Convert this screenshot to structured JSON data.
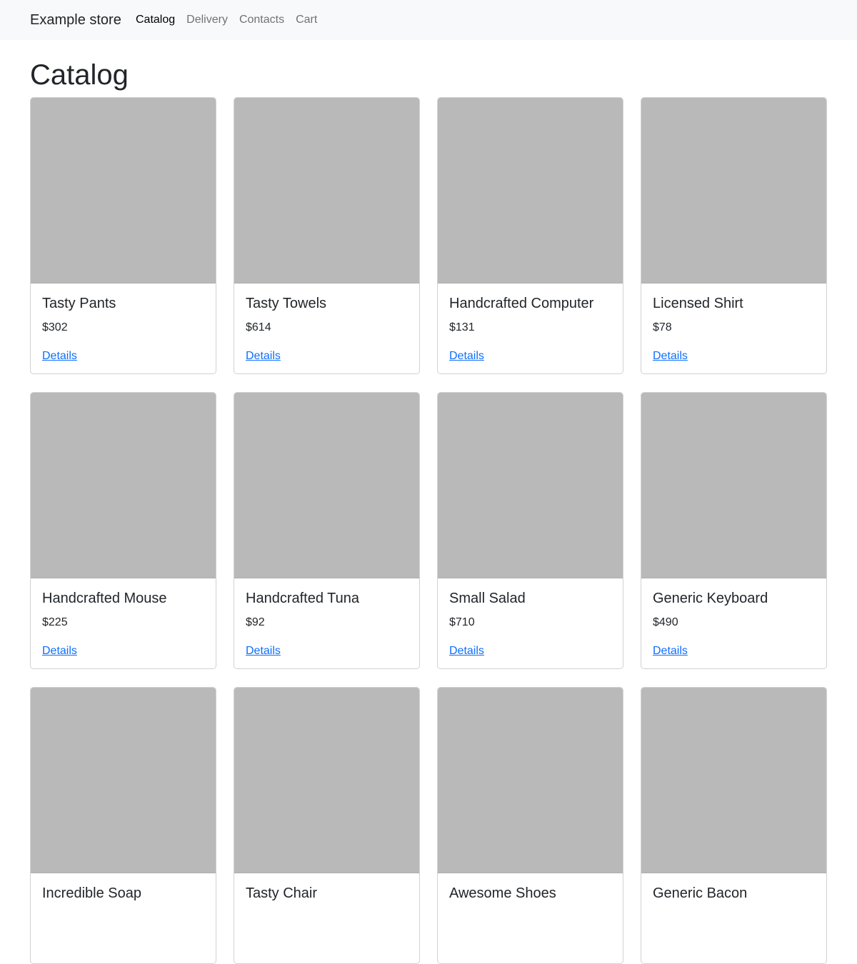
{
  "navbar": {
    "brand": "Example store",
    "links": [
      {
        "label": "Catalog",
        "active": true
      },
      {
        "label": "Delivery",
        "active": false
      },
      {
        "label": "Contacts",
        "active": false
      },
      {
        "label": "Cart",
        "active": false
      }
    ]
  },
  "page": {
    "title": "Catalog"
  },
  "colors": {
    "navbar_bg": "#f8f9fa",
    "image_placeholder": "#b9b9b9",
    "link": "#0d6efd"
  },
  "products": [
    {
      "name": "Tasty Pants",
      "price": "$302",
      "link": "Details"
    },
    {
      "name": "Tasty Towels",
      "price": "$614",
      "link": "Details"
    },
    {
      "name": "Handcrafted Computer",
      "price": "$131",
      "link": "Details"
    },
    {
      "name": "Licensed Shirt",
      "price": "$78",
      "link": "Details"
    },
    {
      "name": "Handcrafted Mouse",
      "price": "$225",
      "link": "Details"
    },
    {
      "name": "Handcrafted Tuna",
      "price": "$92",
      "link": "Details"
    },
    {
      "name": "Small Salad",
      "price": "$710",
      "link": "Details"
    },
    {
      "name": "Generic Keyboard",
      "price": "$490",
      "link": "Details"
    },
    {
      "name": "Incredible Soap",
      "price": "",
      "link": ""
    },
    {
      "name": "Tasty Chair",
      "price": "",
      "link": ""
    },
    {
      "name": "Awesome Shoes",
      "price": "",
      "link": ""
    },
    {
      "name": "Generic Bacon",
      "price": "",
      "link": ""
    }
  ]
}
